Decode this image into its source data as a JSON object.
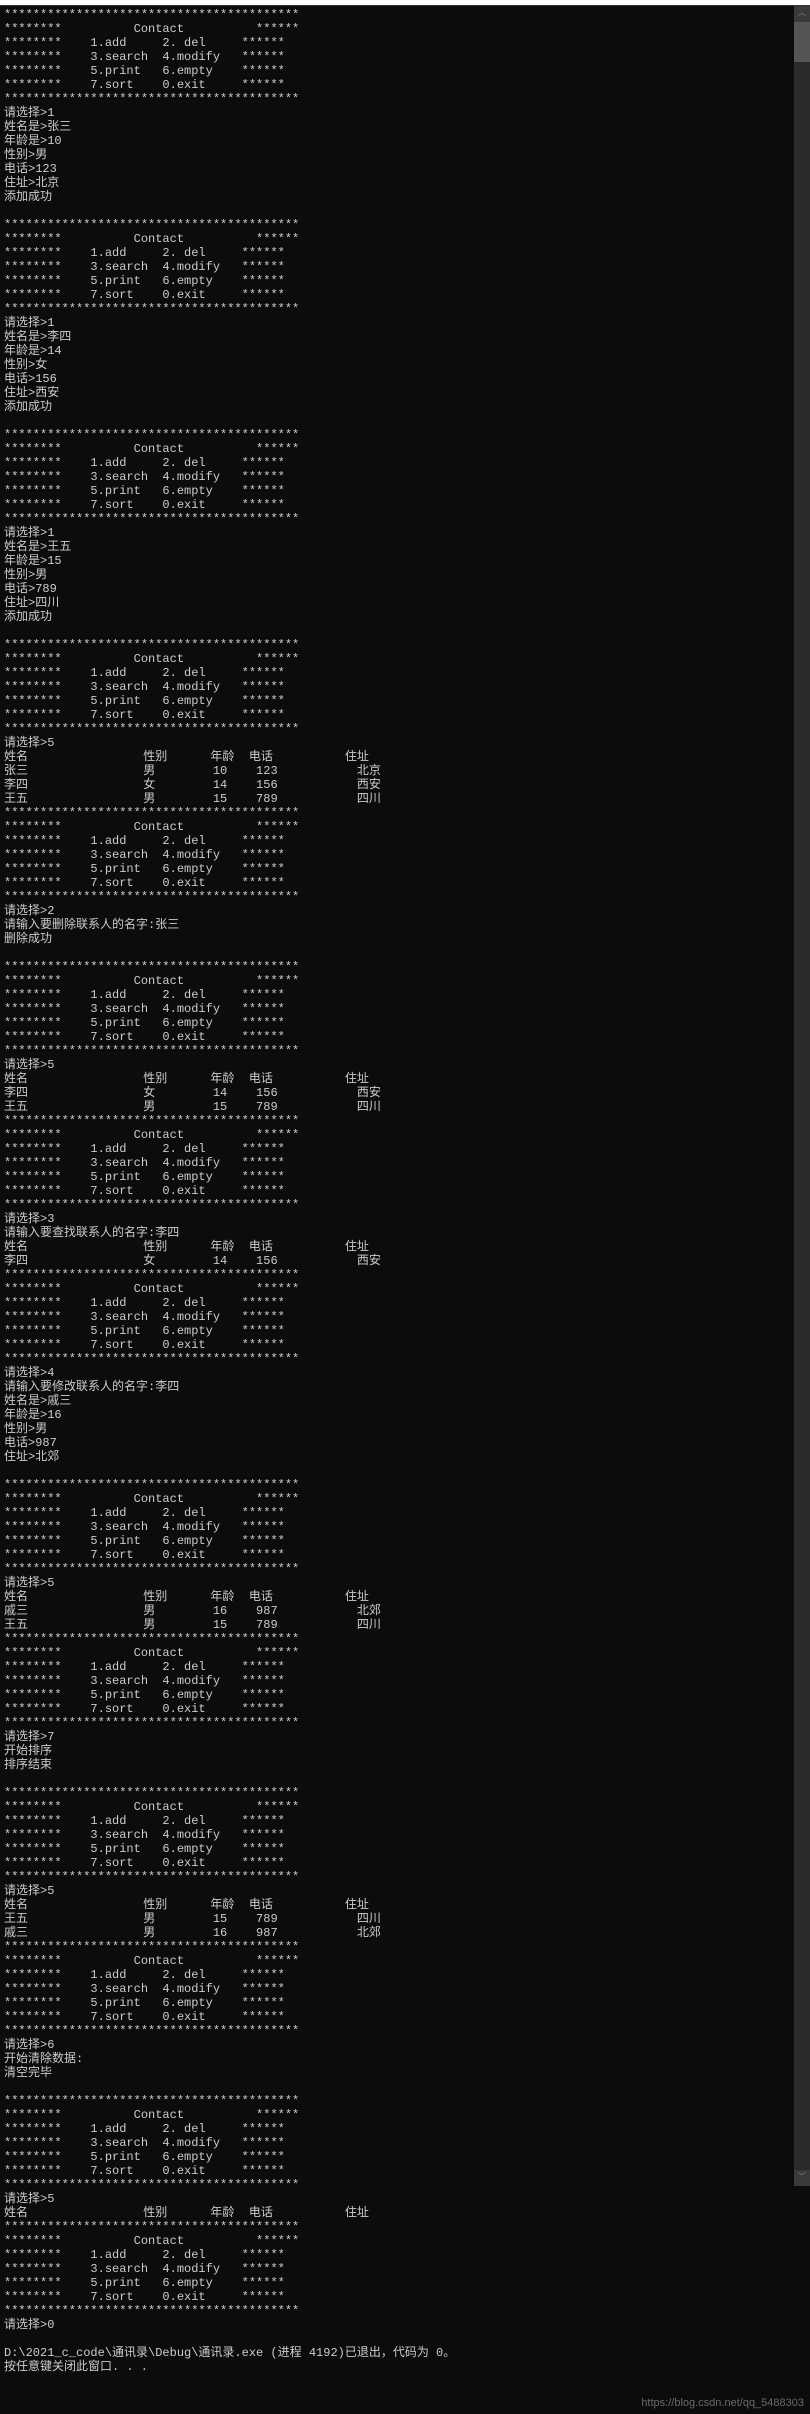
{
  "menu": {
    "star_row": "*****************************************",
    "title_row": "********          Contact          ******",
    "row1": "********    1.add     2. del     ******",
    "row2": "********    3.search  4.modify   ******",
    "row3": "********    5.print   6.empty    ******",
    "row4": "********    7.sort    0.exit     ******"
  },
  "labels": {
    "choose": "请选择>",
    "name_is": "姓名是>",
    "age_is": "年龄是>",
    "sex": "性别>",
    "tel": "电话>",
    "addr": "住址>",
    "add_ok": "添加成功",
    "del_ok": "删除成功",
    "del_prompt": "请输入要删除联系人的名字:",
    "search_prompt": "请输入要查找联系人的名字:",
    "modify_prompt": "请输入要修改联系人的名字:",
    "sort_start": "开始排序",
    "sort_end": "排序结束",
    "clear_start": "开始清除数据:",
    "clear_end": "清空完毕",
    "hdr_name": "姓名",
    "hdr_sex": "性别",
    "hdr_age": "年龄",
    "hdr_tel": "电话",
    "hdr_addr": "住址",
    "exit_line": "D:\\2021_c_code\\通讯录\\Debug\\通讯录.exe (进程 4192)已退出，代码为 0。",
    "press_key": "按任意键关闭此窗口. . ."
  },
  "inputs": {
    "c1": "1",
    "c2": "1",
    "c3": "1",
    "c5a": "5",
    "c2b": "2",
    "c5b": "5",
    "c3b": "3",
    "c4": "4",
    "c5c": "5",
    "c7": "7",
    "c5d": "5",
    "c6": "6",
    "c5e": "5",
    "c0": "0",
    "p1": {
      "name": "张三",
      "age": "10",
      "sex": "男",
      "tel": "123",
      "addr": "北京"
    },
    "p2": {
      "name": "李四",
      "age": "14",
      "sex": "女",
      "tel": "156",
      "addr": "西安"
    },
    "p3": {
      "name": "王五",
      "age": "15",
      "sex": "男",
      "tel": "789",
      "addr": "四川"
    },
    "del_name": "张三",
    "search_name": "李四",
    "modify_name": "李四",
    "pm": {
      "name": "戚三",
      "age": "16",
      "sex": "男",
      "tel": "987",
      "addr": "北郊"
    }
  },
  "tables": {
    "t1": [
      {
        "name": "张三",
        "sex": "男",
        "age": "10",
        "tel": "123",
        "addr": "北京"
      },
      {
        "name": "李四",
        "sex": "女",
        "age": "14",
        "tel": "156",
        "addr": "西安"
      },
      {
        "name": "王五",
        "sex": "男",
        "age": "15",
        "tel": "789",
        "addr": "四川"
      }
    ],
    "t2": [
      {
        "name": "李四",
        "sex": "女",
        "age": "14",
        "tel": "156",
        "addr": "西安"
      },
      {
        "name": "王五",
        "sex": "男",
        "age": "15",
        "tel": "789",
        "addr": "四川"
      }
    ],
    "t3": [
      {
        "name": "李四",
        "sex": "女",
        "age": "14",
        "tel": "156",
        "addr": "西安"
      }
    ],
    "t4": [
      {
        "name": "戚三",
        "sex": "男",
        "age": "16",
        "tel": "987",
        "addr": "北郊"
      },
      {
        "name": "王五",
        "sex": "男",
        "age": "15",
        "tel": "789",
        "addr": "四川"
      }
    ],
    "t5": [
      {
        "name": "王五",
        "sex": "男",
        "age": "15",
        "tel": "789",
        "addr": "四川"
      },
      {
        "name": "戚三",
        "sex": "男",
        "age": "16",
        "tel": "987",
        "addr": "北郊"
      }
    ]
  },
  "watermark": "https://blog.csdn.net/qq_5488303"
}
